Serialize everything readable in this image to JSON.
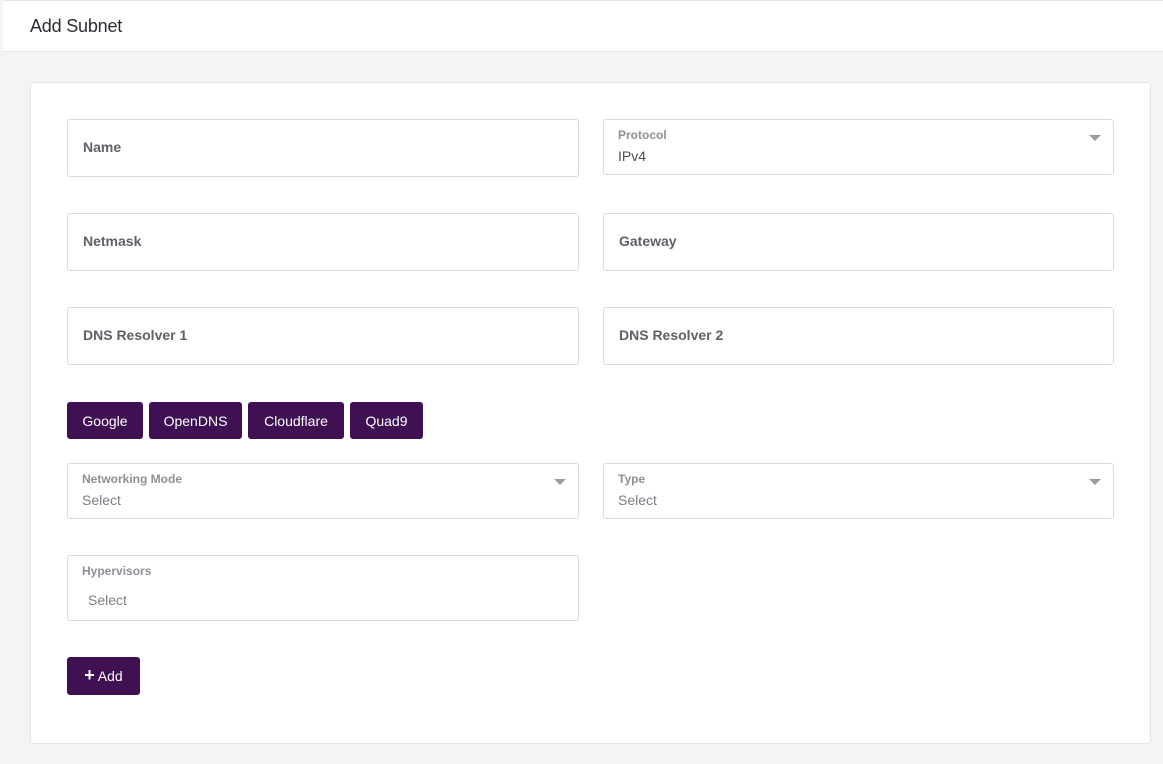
{
  "header": {
    "title": "Add Subnet"
  },
  "form": {
    "name": {
      "label": "Name"
    },
    "protocol": {
      "label": "Protocol",
      "value": "IPv4"
    },
    "netmask": {
      "label": "Netmask"
    },
    "gateway": {
      "label": "Gateway"
    },
    "dns1": {
      "label": "DNS Resolver 1"
    },
    "dns2": {
      "label": "DNS Resolver 2"
    },
    "dns_presets": [
      "Google",
      "OpenDNS",
      "Cloudflare",
      "Quad9"
    ],
    "networking_mode": {
      "label": "Networking Mode",
      "placeholder": "Select"
    },
    "type": {
      "label": "Type",
      "placeholder": "Select"
    },
    "hypervisors": {
      "label": "Hypervisors",
      "placeholder": "Select"
    },
    "add_button": {
      "icon": "plus-icon",
      "label": "Add"
    }
  },
  "colors": {
    "primary": "#3f1052",
    "background": "#f3f4f6",
    "border": "#d9dadf"
  }
}
